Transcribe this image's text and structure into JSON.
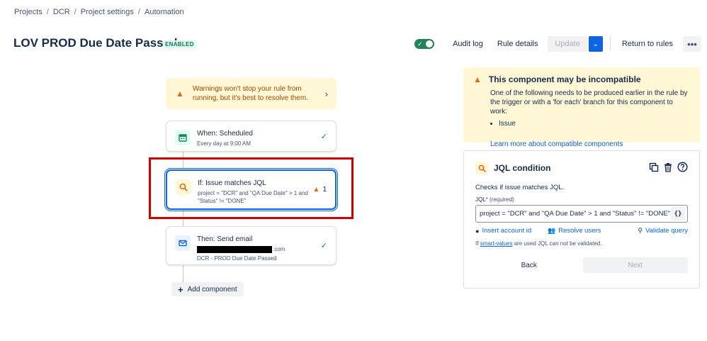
{
  "breadcrumb": [
    "Projects",
    "DCR",
    "Project settings",
    "Automation"
  ],
  "header": {
    "title": "LOV PROD Due Date Passed",
    "status": "ENABLED",
    "audit_log": "Audit log",
    "rule_details": "Rule details",
    "update": "Update",
    "return_to_rules": "Return to rules",
    "more": "•••"
  },
  "canvas": {
    "warning_text": "Warnings won't stop your rule from running, but it's best to resolve them.",
    "trigger": {
      "title": "When: Scheduled",
      "subtitle": "Every day at 9:00 AM"
    },
    "condition": {
      "title": "If: Issue matches JQL",
      "subtitle": "project = \"DCR\" and \"QA Due Date\" > 1 and \"Status\" != \"DONE\"",
      "warnings": "1"
    },
    "action": {
      "title": "Then: Send email",
      "email_suffix": ".com",
      "subtitle": "DCR - PROD Due Date Passed"
    },
    "add_component": "Add component"
  },
  "incompatible": {
    "title": "This component may be incompatible",
    "body": "One of the following needs to be produced earlier in the rule by the trigger or with a 'for each' branch for this component to work:",
    "items": [
      "Issue"
    ],
    "learn_more": "Learn more about compatible components"
  },
  "jql_panel": {
    "title": "JQL condition",
    "description": "Checks if issue matches JQL.",
    "field_label": "JQL",
    "field_required": "* (required)",
    "value": "project = \"DCR\" and \"QA Due Date\" > 1 and \"Status\" != \"DONE\"",
    "smart_values_btn": "{}",
    "insert_account": "Insert account id",
    "resolve_users": "Resolve users",
    "validate_query": "Validate query",
    "note_prefix": "If ",
    "note_link": "smart-values",
    "note_suffix": " are used JQL can not be validated.",
    "back": "Back",
    "next": "Next"
  },
  "colors": {
    "accent": "#0c66e4",
    "success": "#1f845a",
    "warning": "#e56910",
    "highlight": "#d00000"
  }
}
